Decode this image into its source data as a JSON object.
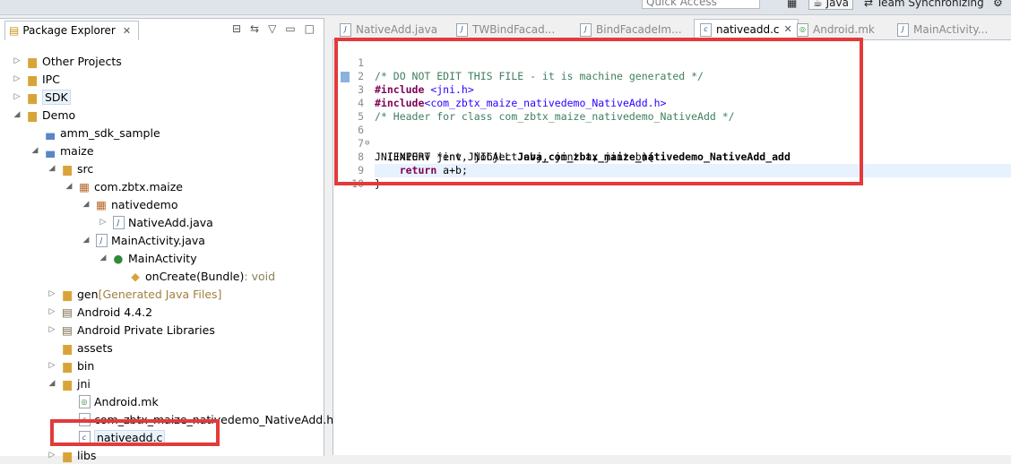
{
  "top": {
    "quick_access": "Quick Access",
    "perspective_java": "Java",
    "perspective_team": "Team Synchronizing"
  },
  "explorer": {
    "title": "Package Explorer",
    "items": [
      {
        "label": "Other Projects",
        "suffix": ""
      },
      {
        "label": "IPC",
        "suffix": ""
      },
      {
        "label": "SDK",
        "suffix": ""
      },
      {
        "label": "Demo",
        "suffix": ""
      },
      {
        "label": "amm_sdk_sample",
        "suffix": ""
      },
      {
        "label": "maize",
        "suffix": ""
      },
      {
        "label": "src",
        "suffix": ""
      },
      {
        "label": "com.zbtx.maize",
        "suffix": ""
      },
      {
        "label": "nativedemo",
        "suffix": ""
      },
      {
        "label": "NativeAdd.java",
        "suffix": ""
      },
      {
        "label": "MainActivity.java",
        "suffix": ""
      },
      {
        "label": "MainActivity",
        "suffix": ""
      },
      {
        "label": "onCreate(Bundle)",
        "suffix": " : void"
      },
      {
        "label": "gen",
        "suffix": " [Generated Java Files]"
      },
      {
        "label": "Android 4.4.2",
        "suffix": ""
      },
      {
        "label": "Android Private Libraries",
        "suffix": ""
      },
      {
        "label": "assets",
        "suffix": ""
      },
      {
        "label": "bin",
        "suffix": ""
      },
      {
        "label": "jni",
        "suffix": ""
      },
      {
        "label": "Android.mk",
        "suffix": ""
      },
      {
        "label": "com_zbtx_maize_nativedemo_NativeAdd.h",
        "suffix": ""
      },
      {
        "label": "nativeadd.c",
        "suffix": ""
      },
      {
        "label": "libs",
        "suffix": ""
      }
    ]
  },
  "editor": {
    "tabs": [
      {
        "label": "NativeAdd.java"
      },
      {
        "label": "TWBindFacad..."
      },
      {
        "label": "BindFacadeIm..."
      },
      {
        "label": "nativeadd.c"
      },
      {
        "label": "Android.mk"
      },
      {
        "label": "MainActivity..."
      }
    ],
    "lines": [
      {
        "n": "1",
        "parts": [
          "/* DO NOT EDIT THIS FILE - it is machine generated */"
        ]
      },
      {
        "n": "2",
        "parts": [
          "#include ",
          "<jni.h>"
        ]
      },
      {
        "n": "3",
        "parts": [
          "#include",
          "<com_zbtx_maize_nativedemo_NativeAdd.h>"
        ]
      },
      {
        "n": "4",
        "parts": [
          "/* Header for class com_zbtx_maize_nativedemo_NativeAdd */"
        ]
      },
      {
        "n": "5",
        "parts": [
          ""
        ]
      },
      {
        "n": "6",
        "parts": [
          "JNIEXPORT jint JNICALL ",
          "Java_com_zbtx_maize_nativedemo_NativeAdd_add"
        ]
      },
      {
        "n": "7",
        "parts": [
          "  (JNIEnv *env, jobject obj, jint a, jint b){"
        ]
      },
      {
        "n": "8",
        "parts": [
          "    ",
          "return",
          " a+b;"
        ]
      },
      {
        "n": "9",
        "parts": [
          "}"
        ]
      },
      {
        "n": "10",
        "parts": [
          ""
        ]
      }
    ]
  }
}
